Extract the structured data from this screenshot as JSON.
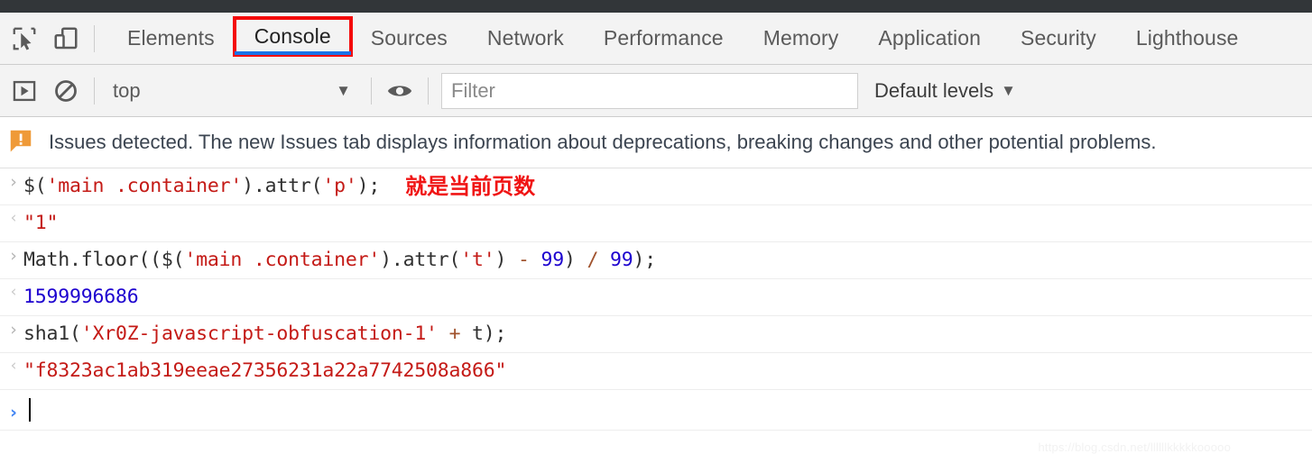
{
  "devtools": {
    "left_icons": [
      {
        "name": "inspect-element-icon"
      },
      {
        "name": "device-toolbar-icon"
      }
    ],
    "tabs": [
      {
        "label": "Elements",
        "active": false,
        "annotated": false
      },
      {
        "label": "Console",
        "active": true,
        "annotated": true
      },
      {
        "label": "Sources",
        "active": false,
        "annotated": false
      },
      {
        "label": "Network",
        "active": false,
        "annotated": false
      },
      {
        "label": "Performance",
        "active": false,
        "annotated": false
      },
      {
        "label": "Memory",
        "active": false,
        "annotated": false
      },
      {
        "label": "Application",
        "active": false,
        "annotated": false
      },
      {
        "label": "Security",
        "active": false,
        "annotated": false
      },
      {
        "label": "Lighthouse",
        "active": false,
        "annotated": false
      }
    ],
    "annotation_box_color": "#f40b0b",
    "active_tab_underline_color": "#1a73e8"
  },
  "console_toolbar": {
    "sidebar_toggle_icon": "show-console-sidebar-icon",
    "clear_icon": "clear-console-icon",
    "context_selected": "top",
    "context_caret": "▼",
    "eye_icon": "live-expression-eye-icon",
    "filter_placeholder": "Filter",
    "filter_value": "",
    "levels_label": "Default levels",
    "levels_caret": "▼"
  },
  "issues_banner": {
    "icon": "issues-warning-icon",
    "icon_color": "#ef9a38",
    "text": "Issues detected. The new Issues tab displays information about deprecations, breaking changes and other potential problems."
  },
  "console_entries": [
    {
      "type": "input",
      "arrow": "›",
      "tokens": [
        {
          "t": "$(",
          "c": "plain"
        },
        {
          "t": "'main .container'",
          "c": "str"
        },
        {
          "t": ").attr(",
          "c": "plain"
        },
        {
          "t": "'p'",
          "c": "str"
        },
        {
          "t": ");",
          "c": "plain"
        }
      ],
      "annotation": "就是当前页数"
    },
    {
      "type": "output",
      "arrow": "‹",
      "tokens": [
        {
          "t": "\"1\"",
          "c": "result-str"
        }
      ]
    },
    {
      "type": "input",
      "arrow": "›",
      "tokens": [
        {
          "t": "Math.floor(($(",
          "c": "plain"
        },
        {
          "t": "'main .container'",
          "c": "str"
        },
        {
          "t": ").attr(",
          "c": "plain"
        },
        {
          "t": "'t'",
          "c": "str"
        },
        {
          "t": ") ",
          "c": "plain"
        },
        {
          "t": "-",
          "c": "op"
        },
        {
          "t": " ",
          "c": "plain"
        },
        {
          "t": "99",
          "c": "num"
        },
        {
          "t": ") ",
          "c": "plain"
        },
        {
          "t": "/",
          "c": "op"
        },
        {
          "t": " ",
          "c": "plain"
        },
        {
          "t": "99",
          "c": "num"
        },
        {
          "t": ");",
          "c": "plain"
        }
      ]
    },
    {
      "type": "output",
      "arrow": "‹",
      "tokens": [
        {
          "t": "1599996686",
          "c": "result-num"
        }
      ]
    },
    {
      "type": "input",
      "arrow": "›",
      "tokens": [
        {
          "t": "sha1(",
          "c": "plain"
        },
        {
          "t": "'Xr0Z-javascript-obfuscation-1'",
          "c": "str"
        },
        {
          "t": " ",
          "c": "plain"
        },
        {
          "t": "+",
          "c": "op"
        },
        {
          "t": " t);",
          "c": "plain"
        }
      ]
    },
    {
      "type": "output",
      "arrow": "‹",
      "tokens": [
        {
          "t": "\"f8323ac1ab319eeae27356231a22a7742508a866\"",
          "c": "result-str"
        }
      ]
    }
  ],
  "prompt": {
    "arrow": "›",
    "value": ""
  },
  "watermark": {
    "text": "https://blog.csdn.net/llllllkkkkkooooo"
  }
}
